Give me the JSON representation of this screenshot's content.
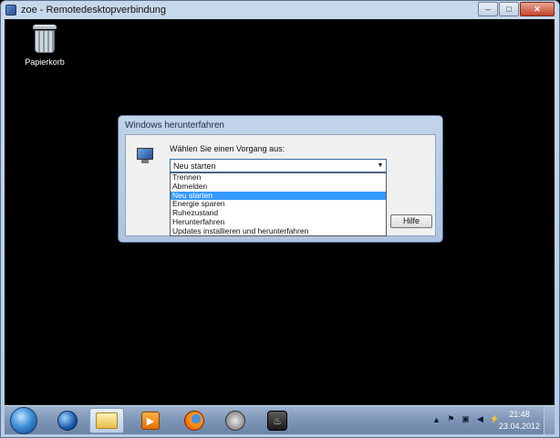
{
  "window": {
    "title": "zoe - Remotedesktopverbindung",
    "minimize_glyph": "‒",
    "maximize_glyph": "□",
    "close_glyph": "✕"
  },
  "desktop": {
    "icons": [
      {
        "label": "Papierkorb",
        "icon": "recycle-bin-icon"
      }
    ]
  },
  "shutdown_dialog": {
    "title": "Windows herunterfahren",
    "prompt": "Wählen Sie einen Vorgang aus:",
    "selected_value": "Neu starten",
    "arrow_glyph": "▼",
    "options": [
      "Trennen",
      "Abmelden",
      "Neu starten",
      "Energie sparen",
      "Ruhezustand",
      "Herunterfahren",
      "Updates installieren und herunterfahren"
    ],
    "highlighted_index": 2,
    "help_label": "Hilfe"
  },
  "taskbar": {
    "items": [
      {
        "icon": "internet-explorer-icon"
      },
      {
        "icon": "explorer-folder-icon",
        "active": true
      },
      {
        "icon": "media-player-icon"
      },
      {
        "icon": "firefox-icon"
      },
      {
        "icon": "tool-app-icon"
      },
      {
        "icon": "steam-icon"
      }
    ],
    "tray_glyphs": [
      "▲",
      "⚑",
      "▣",
      "◀",
      "⚡"
    ],
    "clock_time": "21:48",
    "clock_date": "23.04.2012"
  }
}
